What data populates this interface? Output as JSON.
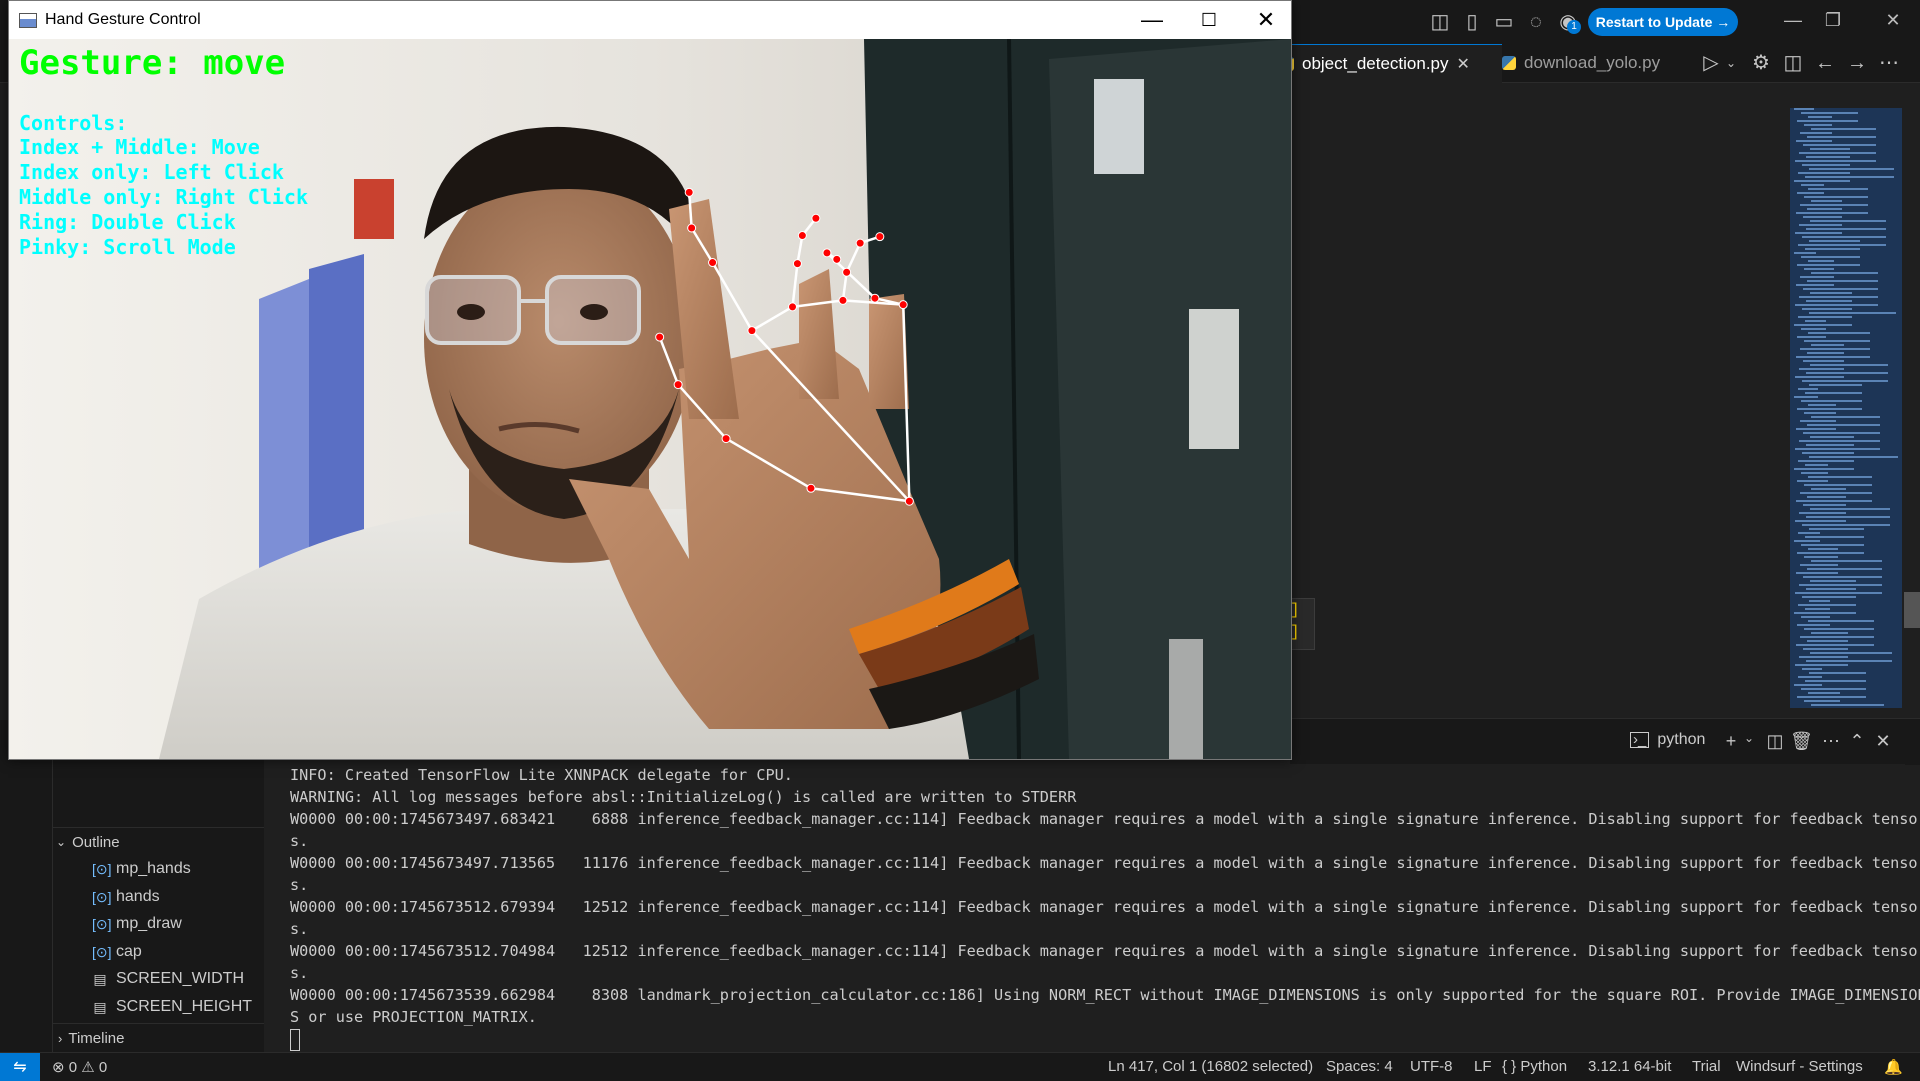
{
  "ide": {
    "restart_label": "Restart to Update →",
    "notification_count": "1",
    "tabs": [
      {
        "label": "object_detection.py",
        "active": true
      },
      {
        "label": "download_yolo.py",
        "active": false
      }
    ],
    "code_fragment": [
      "]",
      "]"
    ]
  },
  "panel": {
    "terminal_name": "python"
  },
  "outline": {
    "header": "Outline",
    "items": [
      {
        "label": "mp_hands",
        "kind": "variable"
      },
      {
        "label": "hands",
        "kind": "variable"
      },
      {
        "label": "mp_draw",
        "kind": "variable"
      },
      {
        "label": "cap",
        "kind": "variable"
      },
      {
        "label": "SCREEN_WIDTH",
        "kind": "constant"
      },
      {
        "label": "SCREEN_HEIGHT",
        "kind": "constant"
      }
    ],
    "timeline_header": "Timeline"
  },
  "terminal": {
    "lines": [
      "INFO: Created TensorFlow Lite XNNPACK delegate for CPU.",
      "WARNING: All log messages before absl::InitializeLog() is called are written to STDERR",
      "W0000 00:00:1745673497.683421    6888 inference_feedback_manager.cc:114] Feedback manager requires a model with a single signature inference. Disabling support for feedback tensor",
      "s.",
      "W0000 00:00:1745673497.713565   11176 inference_feedback_manager.cc:114] Feedback manager requires a model with a single signature inference. Disabling support for feedback tensor",
      "s.",
      "W0000 00:00:1745673512.679394   12512 inference_feedback_manager.cc:114] Feedback manager requires a model with a single signature inference. Disabling support for feedback tensor",
      "s.",
      "W0000 00:00:1745673512.704984   12512 inference_feedback_manager.cc:114] Feedback manager requires a model with a single signature inference. Disabling support for feedback tensor",
      "s.",
      "W0000 00:00:1745673539.662984    8308 landmark_projection_calculator.cc:186] Using NORM_RECT without IMAGE_DIMENSIONS is only supported for the square ROI. Provide IMAGE_DIMENSION",
      "S or use PROJECTION_MATRIX."
    ]
  },
  "statusbar": {
    "errors": "0",
    "warnings": "0",
    "position": "Ln 417, Col 1 (16802 selected)",
    "spaces": "Spaces: 4",
    "encoding": "UTF-8",
    "eol": "LF",
    "language": "Python",
    "interpreter": "3.12.1 64-bit",
    "trial": "Trial",
    "settings": "Windsurf - Settings"
  },
  "gesture_window": {
    "title": "Hand Gesture Control",
    "gesture_text": "Gesture: move",
    "controls": [
      "Controls:",
      "Index + Middle: Move",
      "Index only: Left Click",
      "Middle only: Right Click",
      "Ring: Double Click",
      "Pinky: Scroll Mode"
    ],
    "gesture_color": "#00ff00",
    "controls_color": "#00ffff",
    "landmark_color": "#ff0000",
    "connection_color": "#ffffff"
  }
}
